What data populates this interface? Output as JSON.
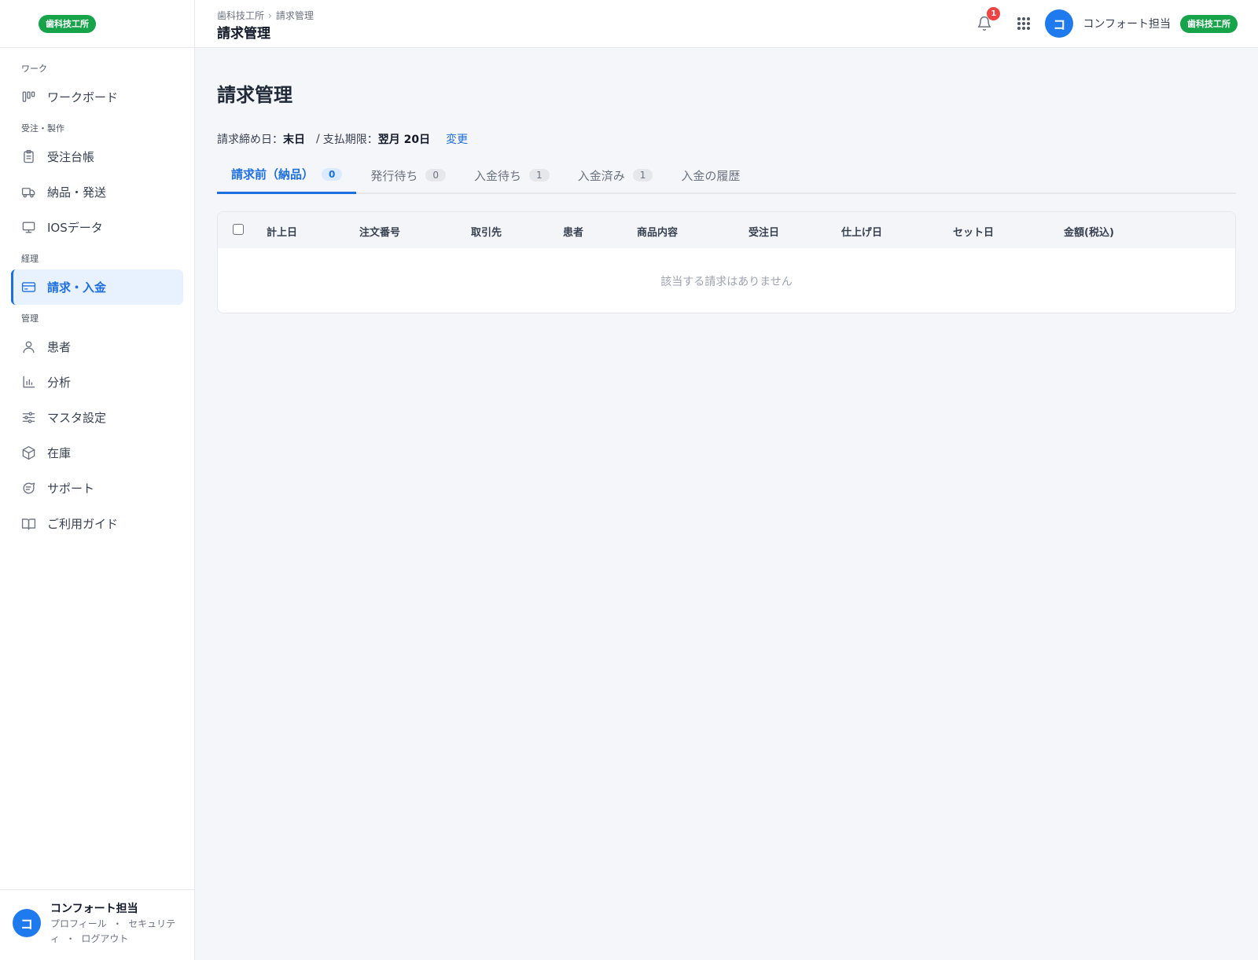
{
  "brand_badge": "歯科技工所",
  "sidebar": {
    "sections": [
      {
        "label": "ワーク",
        "items": [
          {
            "label": "ワークボード",
            "icon": "kanban-icon"
          }
        ]
      },
      {
        "label": "受注・製作",
        "items": [
          {
            "label": "受注台帳",
            "icon": "clipboard-icon"
          },
          {
            "label": "納品・発送",
            "icon": "truck-icon"
          },
          {
            "label": "IOSデータ",
            "icon": "monitor-icon"
          }
        ]
      },
      {
        "label": "経理",
        "items": [
          {
            "label": "請求・入金",
            "icon": "credit-card-icon",
            "active": true
          }
        ]
      },
      {
        "label": "管理",
        "items": [
          {
            "label": "患者",
            "icon": "user-icon"
          },
          {
            "label": "分析",
            "icon": "bar-chart-icon"
          },
          {
            "label": "マスタ設定",
            "icon": "sliders-icon"
          },
          {
            "label": "在庫",
            "icon": "box-icon"
          },
          {
            "label": "サポート",
            "icon": "chat-icon"
          },
          {
            "label": "ご利用ガイド",
            "icon": "book-icon"
          }
        ]
      }
    ],
    "user": {
      "initial": "コ",
      "name": "コンフォート担当",
      "profile_link": "プロフィール",
      "security_link": "セキュリティ",
      "logout_link": "ログアウト",
      "separator": "・"
    }
  },
  "header": {
    "breadcrumb": [
      "歯科技工所",
      "請求管理"
    ],
    "breadcrumb_sep": "›",
    "title": "請求管理",
    "notification_count": "1",
    "user_initial": "コ",
    "user_name": "コンフォート担当",
    "org_badge": "歯科技工所"
  },
  "main": {
    "title": "請求管理",
    "closing_label": "請求締め日：",
    "closing_value": "末日",
    "due_sep": "/",
    "due_label": "支払期限：",
    "due_value": "翌月 20日",
    "change_link": "変更",
    "tabs": [
      {
        "label": "請求前（納品）",
        "count": "0",
        "active": true
      },
      {
        "label": "発行待ち",
        "count": "0"
      },
      {
        "label": "入金待ち",
        "count": "1"
      },
      {
        "label": "入金済み",
        "count": "1"
      },
      {
        "label": "入金の履歴"
      }
    ],
    "table": {
      "columns": [
        "計上日",
        "注文番号",
        "取引先",
        "患者",
        "商品内容",
        "受注日",
        "仕上げ日",
        "セット日",
        "金額(税込)"
      ],
      "empty_message": "該当する請求はありません"
    }
  },
  "colors": {
    "accent": "#1e6fe0",
    "brand_green": "#16a34a",
    "badge_red": "#ef4444"
  }
}
